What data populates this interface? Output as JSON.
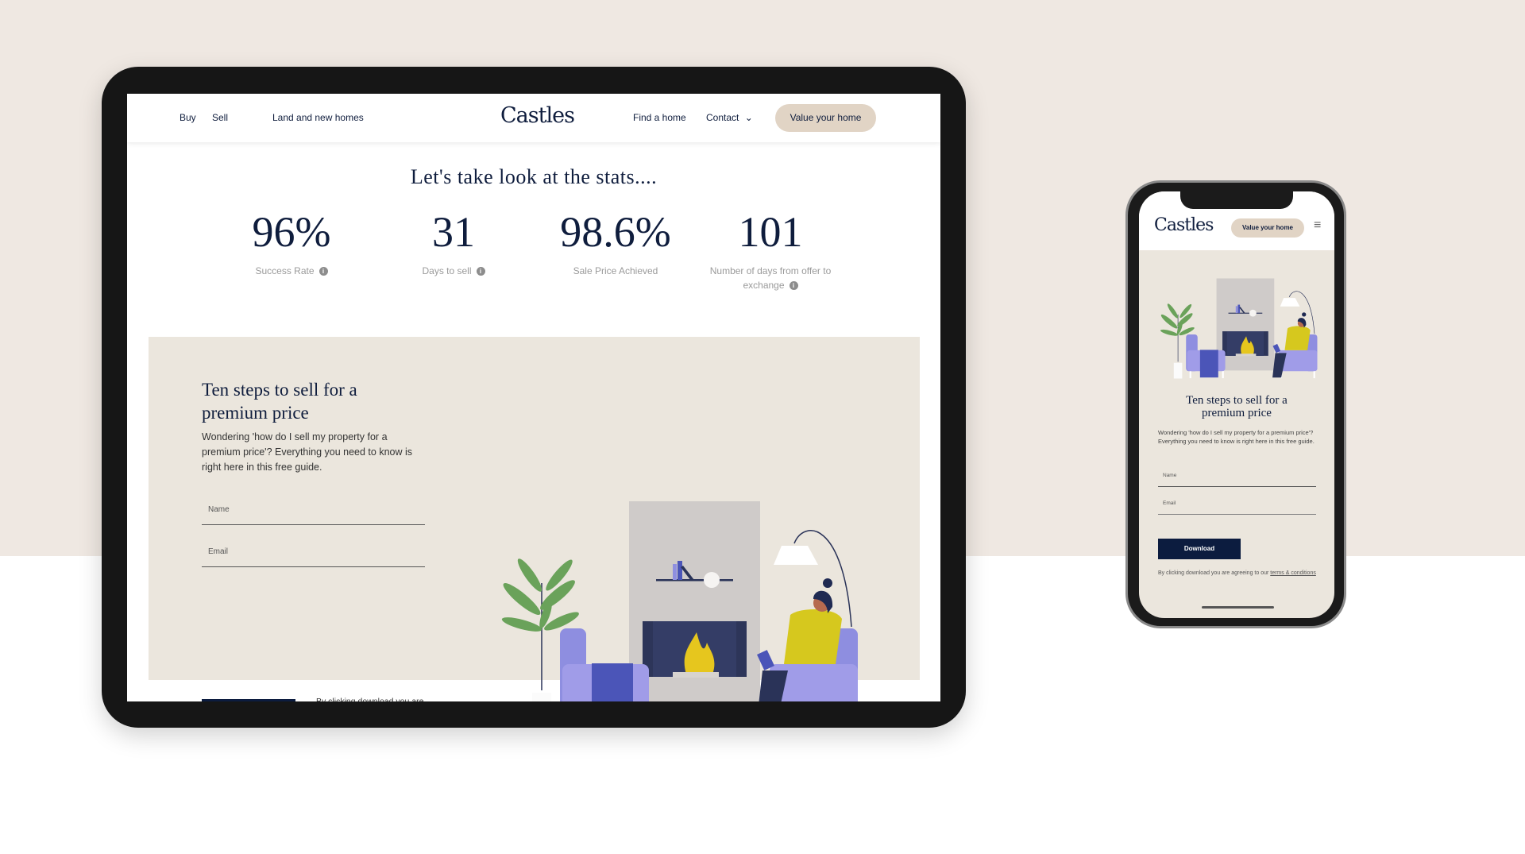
{
  "brand": "Castles",
  "nav": {
    "left": [
      "Buy",
      "Sell",
      "Land and new homes"
    ],
    "right": [
      "Find a home",
      "Contact"
    ],
    "cta": "Value your home"
  },
  "stats_heading": "Let's take look at the stats....",
  "stats": [
    {
      "value": "96%",
      "label": "Success Rate",
      "info": true
    },
    {
      "value": "31",
      "label": "Days to sell",
      "info": true
    },
    {
      "value": "98.6%",
      "label": "Sale Price Achieved",
      "info": false
    },
    {
      "value": "101",
      "label": "Number of days from offer to exchange",
      "info": true
    }
  ],
  "guide": {
    "title": "Ten steps to sell for a premium price",
    "description": "Wondering 'how do I sell my property for a premium price'? Everything you need to know is right here in this free guide.",
    "name_placeholder": "Name",
    "email_placeholder": "Email",
    "download": "Download",
    "terms_prefix": "By clicking download you are agreeing to our ",
    "terms_link": "terms & conditions"
  },
  "icons": {
    "info": "i",
    "chevron": "⌄",
    "menu": "≡"
  },
  "colors": {
    "navy": "#0c1c3f",
    "beige": "#e1d4c5",
    "panel": "#ebe6dd",
    "background": "#efe8e2"
  }
}
